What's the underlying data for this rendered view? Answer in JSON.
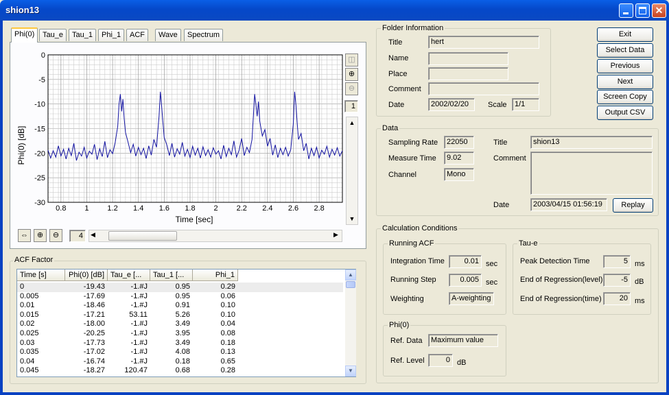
{
  "window": {
    "title": "shion13"
  },
  "tabs": [
    "Phi(0)",
    "Tau_e",
    "Tau_1",
    "Phi_1",
    "ACF",
    "Wave",
    "Spectrum"
  ],
  "chart_data": {
    "type": "line",
    "ylabel": "Phi(0) [dB]",
    "xlabel": "Time [sec]",
    "xlim": [
      0.7,
      2.98
    ],
    "ylim": [
      -30,
      0
    ],
    "yticks": [
      "0",
      "-5",
      "-10",
      "-15",
      "-20",
      "-25",
      "-30"
    ],
    "xticks": [
      "0.8",
      "1",
      "1.2",
      "1.4",
      "1.6",
      "1.8",
      "2",
      "2.2",
      "2.4",
      "2.6",
      "2.8"
    ],
    "grid": true,
    "series": [
      {
        "values": [
          [
            0.7,
            -19.4
          ],
          [
            0.72,
            -21.0
          ],
          [
            0.74,
            -19.5
          ],
          [
            0.76,
            -20.8
          ],
          [
            0.78,
            -18.5
          ],
          [
            0.8,
            -20.6
          ],
          [
            0.82,
            -19.2
          ],
          [
            0.84,
            -21.2
          ],
          [
            0.86,
            -19.0
          ],
          [
            0.88,
            -20.5
          ],
          [
            0.9,
            -18.0
          ],
          [
            0.92,
            -21.5
          ],
          [
            0.94,
            -19.8
          ],
          [
            0.96,
            -20.6
          ],
          [
            0.98,
            -18.8
          ],
          [
            1.0,
            -21.0
          ],
          [
            1.02,
            -19.6
          ],
          [
            1.04,
            -20.2
          ],
          [
            1.06,
            -18.2
          ],
          [
            1.08,
            -21.3
          ],
          [
            1.1,
            -19.1
          ],
          [
            1.12,
            -20.7
          ],
          [
            1.14,
            -17.6
          ],
          [
            1.16,
            -20.9
          ],
          [
            1.18,
            -19.3
          ],
          [
            1.2,
            -20.1
          ],
          [
            1.22,
            -17.9
          ],
          [
            1.24,
            -14.5
          ],
          [
            1.25,
            -10.0
          ],
          [
            1.26,
            -8.0
          ],
          [
            1.27,
            -11.5
          ],
          [
            1.28,
            -9.0
          ],
          [
            1.29,
            -13.0
          ],
          [
            1.3,
            -15.8
          ],
          [
            1.32,
            -17.8
          ],
          [
            1.34,
            -19.9
          ],
          [
            1.36,
            -18.2
          ],
          [
            1.38,
            -20.6
          ],
          [
            1.4,
            -18.8
          ],
          [
            1.42,
            -20.3
          ],
          [
            1.44,
            -19.0
          ],
          [
            1.46,
            -21.1
          ],
          [
            1.48,
            -18.5
          ],
          [
            1.5,
            -20.4
          ],
          [
            1.52,
            -17.2
          ],
          [
            1.54,
            -18.8
          ],
          [
            1.56,
            -12.5
          ],
          [
            1.57,
            -7.5
          ],
          [
            1.58,
            -10.5
          ],
          [
            1.59,
            -13.8
          ],
          [
            1.6,
            -16.8
          ],
          [
            1.62,
            -18.3
          ],
          [
            1.64,
            -20.5
          ],
          [
            1.66,
            -18.0
          ],
          [
            1.68,
            -20.8
          ],
          [
            1.7,
            -19.1
          ],
          [
            1.72,
            -20.2
          ],
          [
            1.74,
            -17.8
          ],
          [
            1.76,
            -20.6
          ],
          [
            1.78,
            -19.2
          ],
          [
            1.8,
            -20.9
          ],
          [
            1.82,
            -18.6
          ],
          [
            1.84,
            -20.4
          ],
          [
            1.86,
            -19.0
          ],
          [
            1.88,
            -21.0
          ],
          [
            1.9,
            -18.7
          ],
          [
            1.92,
            -20.5
          ],
          [
            1.94,
            -19.3
          ],
          [
            1.96,
            -20.8
          ],
          [
            1.98,
            -18.9
          ],
          [
            2.0,
            -20.2
          ],
          [
            2.02,
            -19.5
          ],
          [
            2.04,
            -21.2
          ],
          [
            2.06,
            -18.4
          ],
          [
            2.08,
            -20.7
          ],
          [
            2.1,
            -19.0
          ],
          [
            2.12,
            -20.3
          ],
          [
            2.14,
            -17.5
          ],
          [
            2.16,
            -20.8
          ],
          [
            2.18,
            -19.4
          ],
          [
            2.2,
            -17.0
          ],
          [
            2.22,
            -20.5
          ],
          [
            2.24,
            -18.8
          ],
          [
            2.26,
            -19.9
          ],
          [
            2.28,
            -17.2
          ],
          [
            2.3,
            -8.0
          ],
          [
            2.31,
            -10.0
          ],
          [
            2.32,
            -12.5
          ],
          [
            2.33,
            -9.5
          ],
          [
            2.34,
            -13.5
          ],
          [
            2.36,
            -16.5
          ],
          [
            2.38,
            -15.2
          ],
          [
            2.4,
            -18.6
          ],
          [
            2.42,
            -17.0
          ],
          [
            2.44,
            -20.4
          ],
          [
            2.46,
            -18.3
          ],
          [
            2.48,
            -20.9
          ],
          [
            2.5,
            -19.0
          ],
          [
            2.52,
            -20.3
          ],
          [
            2.54,
            -18.8
          ],
          [
            2.56,
            -20.6
          ],
          [
            2.58,
            -19.3
          ],
          [
            2.6,
            -14.0
          ],
          [
            2.61,
            -7.5
          ],
          [
            2.62,
            -10.2
          ],
          [
            2.63,
            -13.8
          ],
          [
            2.64,
            -17.2
          ],
          [
            2.66,
            -16.0
          ],
          [
            2.68,
            -19.5
          ],
          [
            2.7,
            -18.0
          ],
          [
            2.72,
            -21.2
          ],
          [
            2.74,
            -19.0
          ],
          [
            2.76,
            -20.5
          ],
          [
            2.78,
            -18.8
          ],
          [
            2.8,
            -21.0
          ],
          [
            2.82,
            -19.4
          ],
          [
            2.84,
            -20.2
          ],
          [
            2.86,
            -18.6
          ],
          [
            2.88,
            -20.8
          ],
          [
            2.9,
            -19.2
          ],
          [
            2.92,
            -20.4
          ],
          [
            2.94,
            -18.9
          ],
          [
            2.96,
            -20.6
          ],
          [
            2.98,
            -19.5
          ]
        ]
      }
    ]
  },
  "chart_tools": {
    "page_value": "1",
    "zoom_level": "4"
  },
  "acf": {
    "title": "ACF Factor",
    "headers": [
      "Time [s]",
      "Phi(0) [dB]",
      "Tau_e [...",
      "Tau_1 [...",
      "Phi_1"
    ],
    "rows": [
      [
        "0",
        "-19.43",
        "-1.#J",
        "0.95",
        "0.29"
      ],
      [
        "0.005",
        "-17.69",
        "-1.#J",
        "0.95",
        "0.06"
      ],
      [
        "0.01",
        "-18.46",
        "-1.#J",
        "0.91",
        "0.10"
      ],
      [
        "0.015",
        "-17.21",
        "53.11",
        "5.26",
        "0.10"
      ],
      [
        "0.02",
        "-18.00",
        "-1.#J",
        "3.49",
        "0.04"
      ],
      [
        "0.025",
        "-20.25",
        "-1.#J",
        "3.95",
        "0.08"
      ],
      [
        "0.03",
        "-17.73",
        "-1.#J",
        "3.49",
        "0.18"
      ],
      [
        "0.035",
        "-17.02",
        "-1.#J",
        "4.08",
        "0.13"
      ],
      [
        "0.04",
        "-16.74",
        "-1.#J",
        "0.18",
        "0.65"
      ],
      [
        "0.045",
        "-18.27",
        "120.47",
        "0.68",
        "0.28"
      ]
    ]
  },
  "folder": {
    "title": "Folder Information",
    "labels": {
      "title": "Title",
      "name": "Name",
      "place": "Place",
      "comment": "Comment",
      "date": "Date",
      "scale": "Scale"
    },
    "values": {
      "title": "hert",
      "name": "",
      "place": "",
      "comment": "",
      "date": "2002/02/20",
      "scale": "1/1"
    }
  },
  "buttons": {
    "exit": "Exit",
    "select": "Select Data",
    "previous": "Previous",
    "next": "Next",
    "screen_copy": "Screen Copy",
    "output_csv": "Output CSV",
    "replay": "Replay"
  },
  "data": {
    "title": "Data",
    "labels": {
      "rate": "Sampling Rate",
      "time": "Measure Time",
      "channel": "Channel",
      "title": "Title",
      "comment": "Comment",
      "date": "Date"
    },
    "values": {
      "rate": "22050",
      "time": "9.02",
      "channel": "Mono",
      "title": "shion13",
      "comment": "",
      "date": "2003/04/15 01:56:19"
    }
  },
  "calc": {
    "title": "Calculation Conditions",
    "running_acf": {
      "title": "Running ACF",
      "integration_label": "Integration Time",
      "integration_value": "0.01",
      "integration_unit": "sec",
      "step_label": "Running Step",
      "step_value": "0.005",
      "step_unit": "sec",
      "weighting_label": "Weighting",
      "weighting_value": "A-weighting"
    },
    "tau_e": {
      "title": "Tau-e",
      "peak_label": "Peak Detection Time",
      "peak_value": "5",
      "peak_unit": "ms",
      "level_label": "End of Regression(level)",
      "level_value": "-5",
      "level_unit": "dB",
      "time_label": "End of Regression(time)",
      "time_value": "20",
      "time_unit": "ms"
    },
    "phi0": {
      "title": "Phi(0)",
      "ref_data_label": "Ref. Data",
      "ref_data_value": "Maximum value",
      "ref_level_label": "Ref. Level",
      "ref_level_value": "0",
      "ref_level_unit": "dB"
    }
  },
  "colors": {
    "plot_line": "#1010A0",
    "title_bar": "#0A5FE6",
    "tab_highlight": "#FFC83C"
  }
}
